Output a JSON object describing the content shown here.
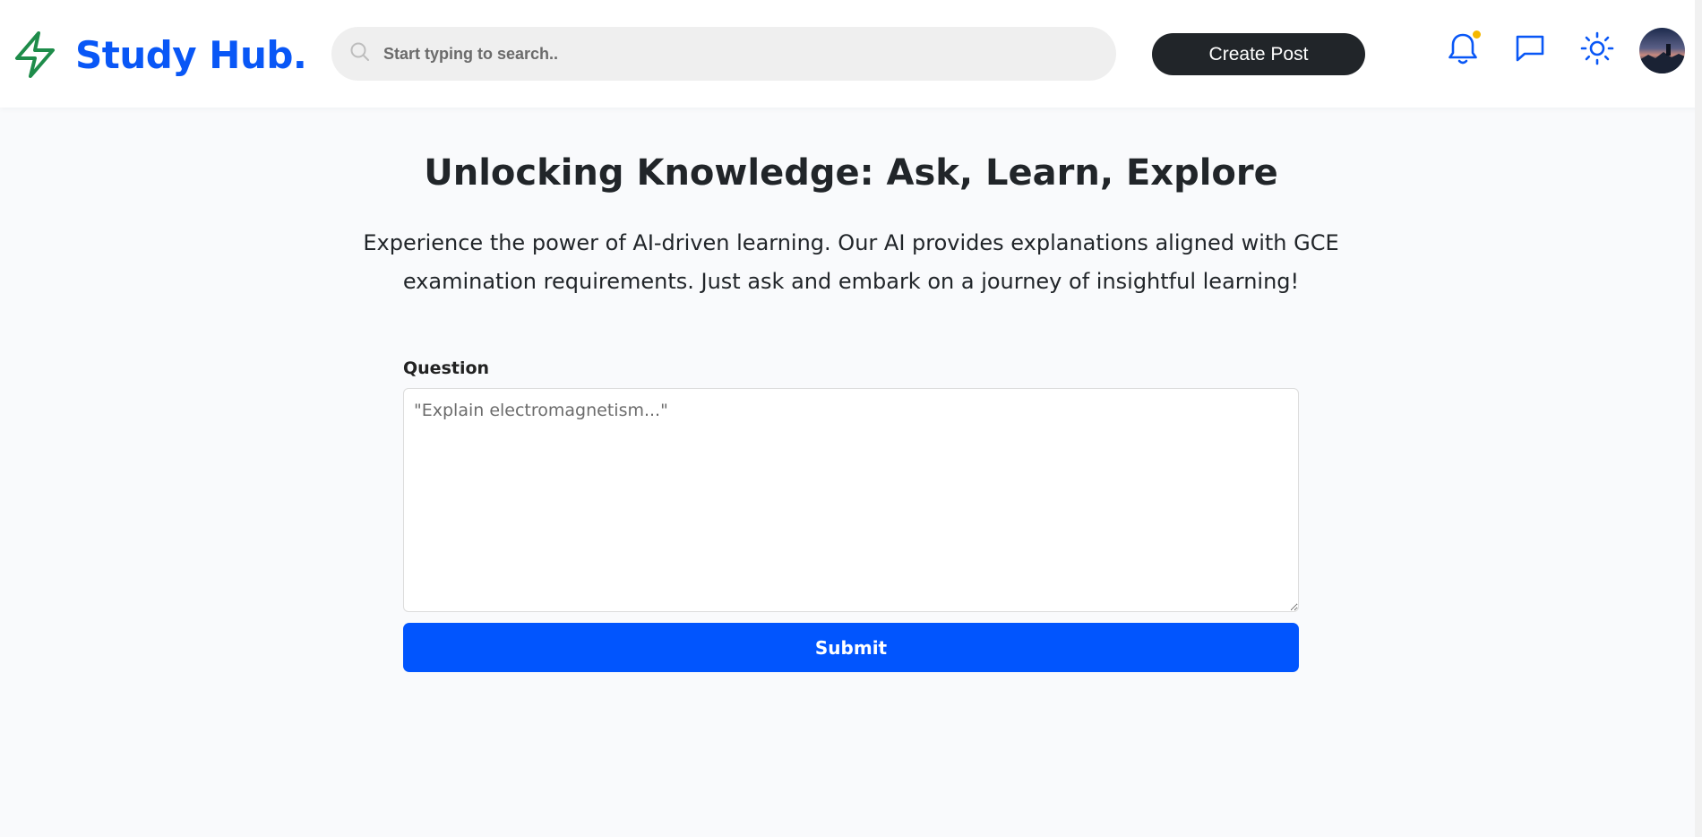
{
  "header": {
    "brand": "Study Hub.",
    "search": {
      "placeholder": "Start typing to search..",
      "value": ""
    },
    "create_post_label": "Create Post",
    "icons": {
      "logo": "lightning-bolt-icon",
      "search": "search-icon",
      "notifications": "bell-icon",
      "messages": "chat-bubble-icon",
      "theme": "sun-icon",
      "avatar": "user-avatar"
    },
    "has_unread_notifications": true
  },
  "main": {
    "title": "Unlocking Knowledge: Ask, Learn, Explore",
    "description": "Experience the power of AI-driven learning. Our AI provides explanations aligned with GCE examination requirements. Just ask and embark on a journey of insightful learning!",
    "form": {
      "question_label": "Question",
      "question_placeholder": "\"Explain electromagnetism...\"",
      "question_value": "",
      "submit_label": "Submit"
    }
  },
  "colors": {
    "brand_blue": "#0957f6",
    "logo_green": "#1e8c4a",
    "submit_blue": "#0155fe",
    "create_post_dark": "#212529",
    "notification_dot": "#f5b800",
    "page_background": "#f9fafc"
  }
}
